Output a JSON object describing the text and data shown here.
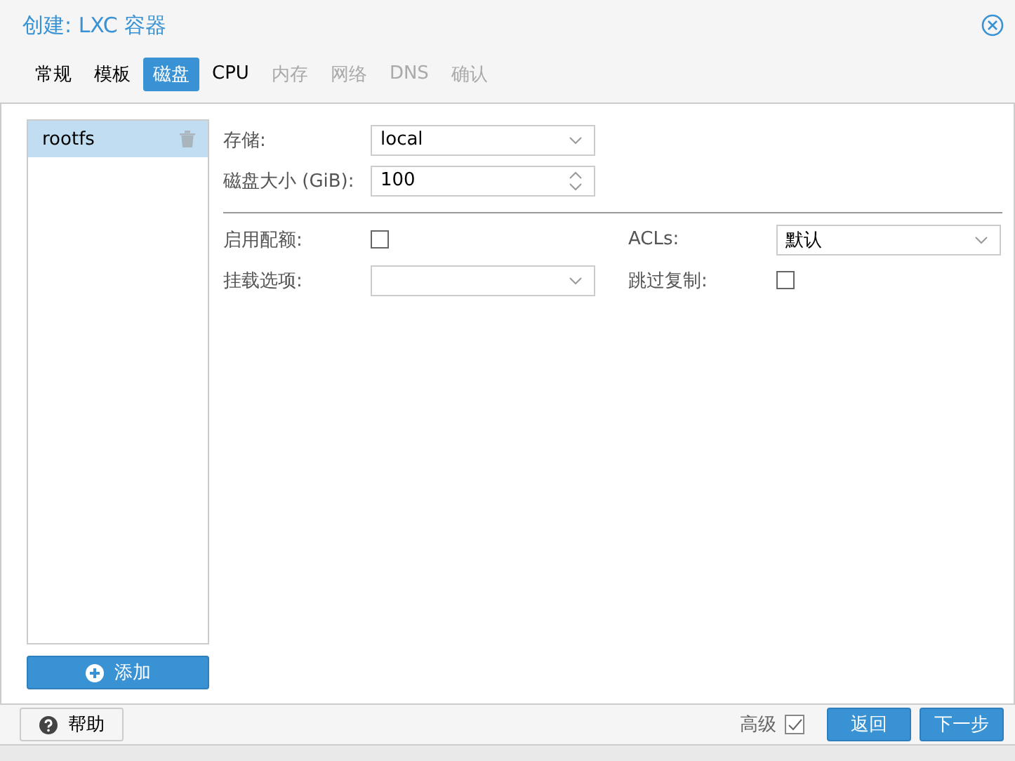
{
  "window": {
    "title": "创建: LXC 容器"
  },
  "tabs": [
    {
      "label": "常规",
      "selected": false,
      "disabled": false
    },
    {
      "label": "模板",
      "selected": false,
      "disabled": false
    },
    {
      "label": "磁盘",
      "selected": true,
      "disabled": false
    },
    {
      "label": "CPU",
      "selected": false,
      "disabled": false
    },
    {
      "label": "内存",
      "selected": false,
      "disabled": true
    },
    {
      "label": "网络",
      "selected": false,
      "disabled": true
    },
    {
      "label": "DNS",
      "selected": false,
      "disabled": true
    },
    {
      "label": "确认",
      "selected": false,
      "disabled": true
    }
  ],
  "disks": [
    {
      "label": "rootfs",
      "selected": true
    }
  ],
  "add_button": "添加",
  "top_fields": [
    {
      "label": "存储:",
      "kind": "select",
      "value": "local"
    },
    {
      "label": "磁盘大小 (GiB):",
      "kind": "spinner",
      "value": "100"
    }
  ],
  "left_fields": [
    {
      "label": "启用配额:",
      "kind": "checkbox",
      "checked": false
    },
    {
      "label": "挂载选项:",
      "kind": "select"
    }
  ],
  "right_fields": [
    {
      "label": "ACLs:",
      "kind": "select",
      "value": "默认"
    },
    {
      "label": "跳过复制:",
      "kind": "checkbox",
      "checked": false
    }
  ],
  "footer": {
    "help": "帮助",
    "advanced_label": "高级",
    "advanced": true,
    "back": "返回",
    "next": "下一步"
  }
}
